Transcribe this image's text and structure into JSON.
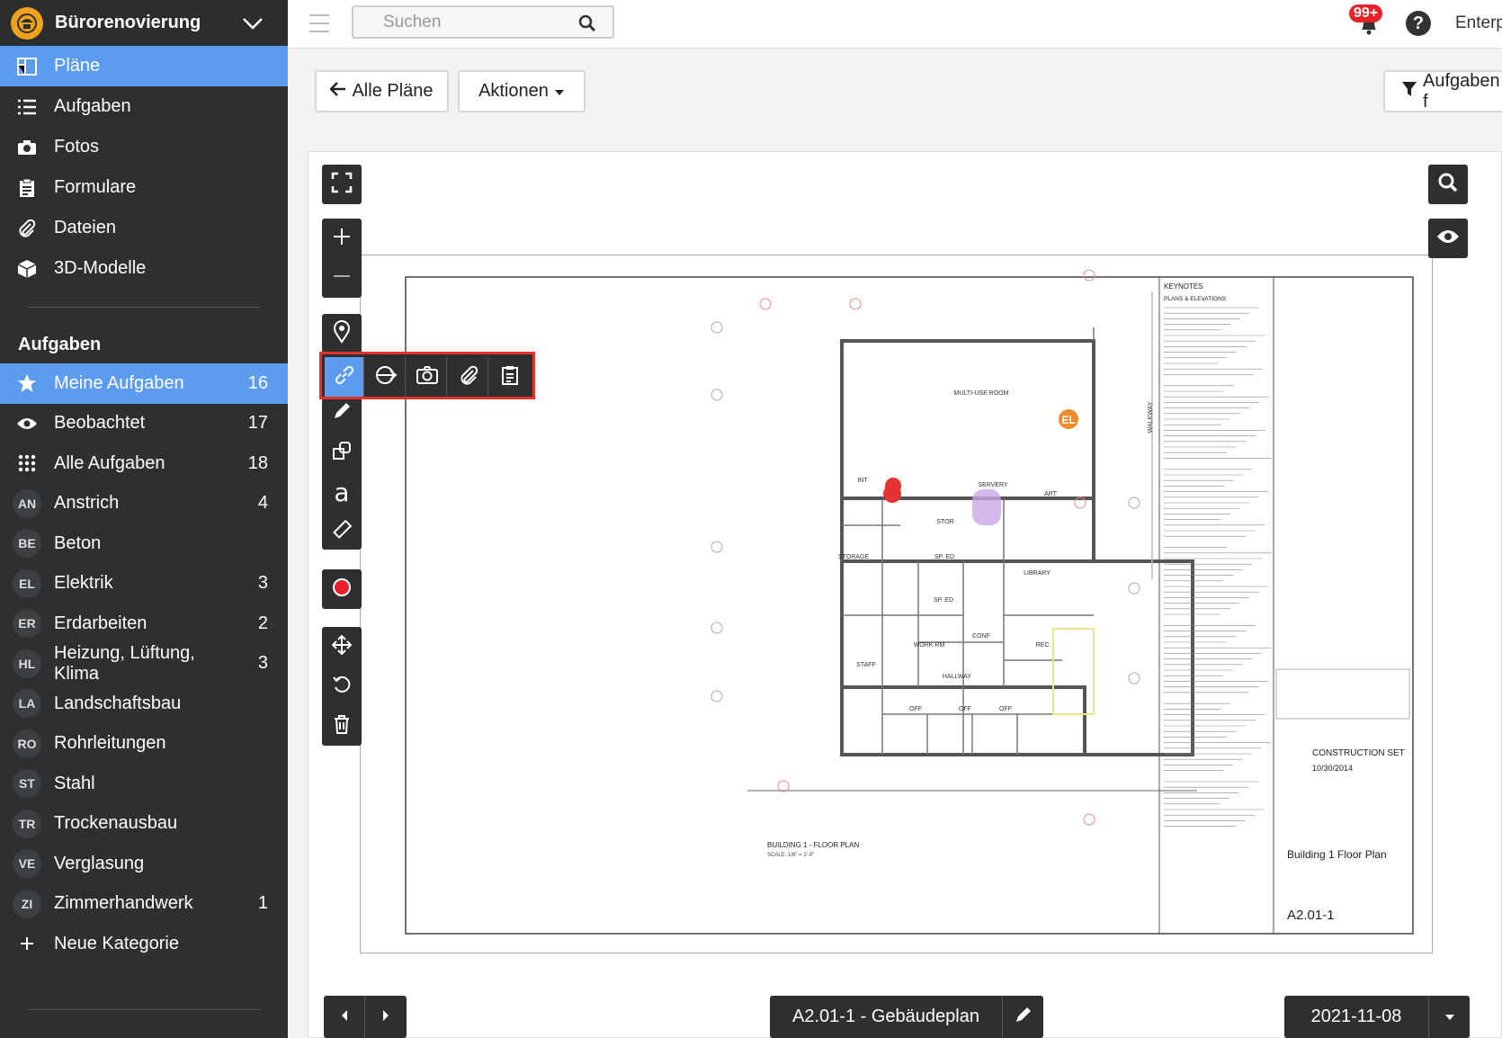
{
  "project": {
    "name": "Bürorenovierung"
  },
  "nav": [
    {
      "label": "Pläne",
      "icon": "plans-icon"
    },
    {
      "label": "Aufgaben",
      "icon": "list-icon"
    },
    {
      "label": "Fotos",
      "icon": "camera-icon"
    },
    {
      "label": "Formulare",
      "icon": "clipboard-icon"
    },
    {
      "label": "Dateien",
      "icon": "paperclip-icon"
    },
    {
      "label": "3D-Modelle",
      "icon": "cube-icon"
    }
  ],
  "tasks_section": {
    "title": "Aufgaben"
  },
  "task_filters": [
    {
      "label": "Meine Aufgaben",
      "count": "16",
      "icon": "star-icon"
    },
    {
      "label": "Beobachtet",
      "count": "17",
      "icon": "eye-icon"
    },
    {
      "label": "Alle Aufgaben",
      "count": "18",
      "icon": "grid-icon"
    }
  ],
  "categories": [
    {
      "abbr": "AN",
      "label": "Anstrich",
      "count": "4"
    },
    {
      "abbr": "BE",
      "label": "Beton",
      "count": ""
    },
    {
      "abbr": "EL",
      "label": "Elektrik",
      "count": "3"
    },
    {
      "abbr": "ER",
      "label": "Erdarbeiten",
      "count": "2"
    },
    {
      "abbr": "HL",
      "label": "Heizung, Lüftung, Klima",
      "count": "3"
    },
    {
      "abbr": "LA",
      "label": "Landschaftsbau",
      "count": ""
    },
    {
      "abbr": "RO",
      "label": "Rohrleitungen",
      "count": ""
    },
    {
      "abbr": "ST",
      "label": "Stahl",
      "count": ""
    },
    {
      "abbr": "TR",
      "label": "Trockenausbau",
      "count": ""
    },
    {
      "abbr": "VE",
      "label": "Verglasung",
      "count": ""
    },
    {
      "abbr": "ZI",
      "label": "Zimmerhandwerk",
      "count": "1"
    }
  ],
  "new_category": {
    "label": "Neue Kategorie"
  },
  "topbar": {
    "search_placeholder": "Suchen",
    "notifications": "99+",
    "help": "?",
    "org": "Enterp"
  },
  "actions": {
    "all_plans": "Alle Pläne",
    "actions": "Aktionen",
    "tasks_filter": "Aufgaben f"
  },
  "plan": {
    "sheet_label": "A2.01-1 - Gebäudeplan",
    "date": "2021-11-08",
    "title_block": {
      "keynotes": "KEYNOTES",
      "plans_elevations": "PLANS & ELEVATIONS",
      "set": "CONSTRUCTION SET",
      "set_date": "10/30/2014",
      "building": "Building 1 Floor Plan",
      "sheet_no": "A2.01-1",
      "plan_title": "BUILDING 1 - FLOOR PLAN",
      "scale": "SCALE: 1/8\" = 1'-0\""
    },
    "rooms": [
      "MULTI-USE ROOM",
      "SERVERY",
      "STOR",
      "STORAGE",
      "SP. ED.",
      "SP. ED",
      "LIBRARY",
      "ART",
      "INT",
      "WORK RM",
      "CONF",
      "REC",
      "STAFF",
      "HALLWAY",
      "OFF",
      "OFF",
      "OFF",
      "WALKWAY"
    ],
    "pin_label": "EL"
  },
  "colors": {
    "accent": "#5b9bf0",
    "sidebar": "#2d2f31",
    "highlight": "#e8302a"
  }
}
